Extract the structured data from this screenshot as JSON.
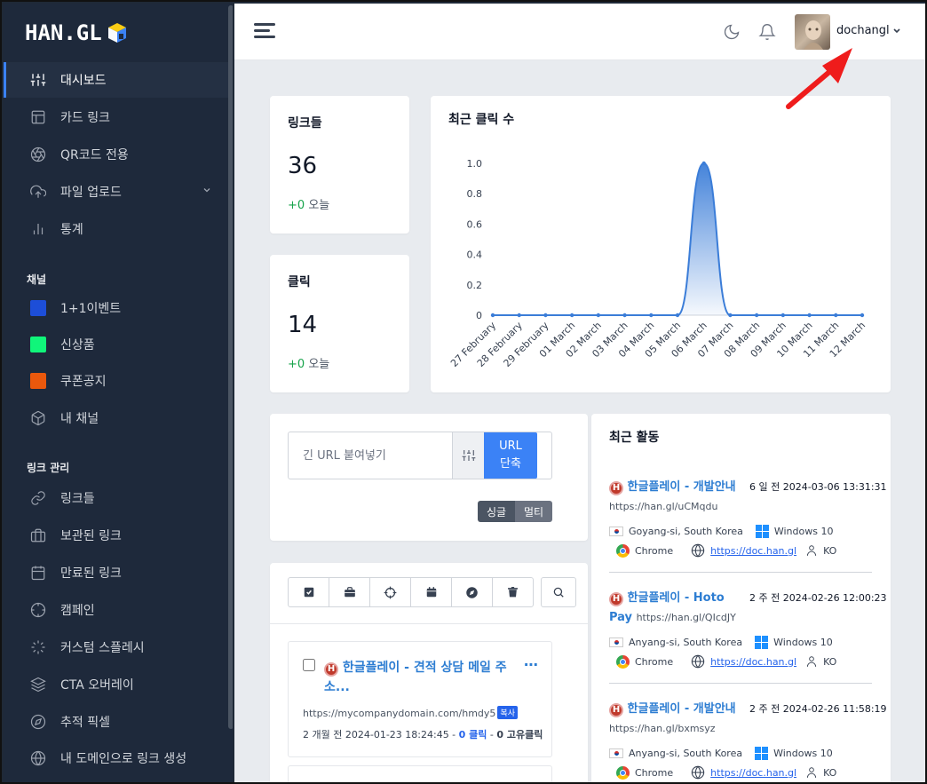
{
  "brand": {
    "logo_text": "HAN.GL"
  },
  "sidebar": {
    "items": [
      {
        "label": "대시보드",
        "icon": "sliders-icon"
      },
      {
        "label": "카드 링크",
        "icon": "layout-icon"
      },
      {
        "label": "QR코드 전용",
        "icon": "aperture-icon"
      },
      {
        "label": "파일 업로드",
        "icon": "upload-cloud-icon"
      },
      {
        "label": "통계",
        "icon": "bar-chart-icon"
      }
    ],
    "channels_title": "채널",
    "channels": [
      {
        "label": "1+1이벤트",
        "color": "#1d4ed8"
      },
      {
        "label": "신상품",
        "color": "#10f57a"
      },
      {
        "label": "쿠폰공지",
        "color": "#ea580c"
      },
      {
        "label": "내 채널",
        "icon": "box-icon"
      }
    ],
    "links_title": "링크 관리",
    "link_items": [
      {
        "label": "링크들",
        "icon": "link-icon"
      },
      {
        "label": "보관된 링크",
        "icon": "briefcase-icon"
      },
      {
        "label": "만료된 링크",
        "icon": "calendar-icon"
      },
      {
        "label": "캠페인",
        "icon": "crosshair-icon"
      },
      {
        "label": "커스텀 스플레시",
        "icon": "loader-icon"
      },
      {
        "label": "CTA 오버레이",
        "icon": "layers-icon"
      },
      {
        "label": "추적 픽셀",
        "icon": "compass-icon"
      },
      {
        "label": "내 도메인으로 링크 생성",
        "icon": "globe-icon"
      }
    ]
  },
  "topbar": {
    "username": "dochangl"
  },
  "stats": {
    "links": {
      "title": "링크들",
      "value": "36",
      "today_delta": "+0",
      "today_label": "오늘"
    },
    "clicks": {
      "title": "클릭",
      "value": "14",
      "today_delta": "+0",
      "today_label": "오늘"
    }
  },
  "chart_data": {
    "type": "area",
    "title": "최근 클릭 수",
    "categories": [
      "27 February",
      "28 February",
      "29 February",
      "01 March",
      "02 March",
      "03 March",
      "04 March",
      "05 March",
      "06 March",
      "07 March",
      "08 March",
      "09 March",
      "10 March",
      "11 March",
      "12 March"
    ],
    "values": [
      0,
      0,
      0,
      0,
      0,
      0,
      0,
      0,
      1,
      0,
      0,
      0,
      0,
      0,
      0
    ],
    "yticks": [
      "0",
      "0.2",
      "0.4",
      "0.6",
      "0.8",
      "1.0"
    ],
    "ylim": [
      0,
      1
    ],
    "color": "#3b7dd8"
  },
  "shorten": {
    "placeholder": "긴 URL 붙여넣기",
    "button_line1": "URL",
    "button_line2": "단축",
    "single": "싱글",
    "multi": "멀티"
  },
  "link_list": {
    "first": {
      "title": "한글플레이 - 견적 상담 메일 주소...",
      "url": "https://mycompanydomain.com/hmdy5",
      "copy": "복사",
      "age": "2 개월 전",
      "date": "2024-01-23 18:24:45",
      "clicks": "0 클릭",
      "unique": "0 고유클릭"
    }
  },
  "activity": {
    "title": "최근 활동",
    "items": [
      {
        "name": "한글플레이 - 개발안내",
        "short": "https://han.gl/uCMqdu",
        "time": "6 일 전 2024-03-06 13:31:31",
        "location": "Goyang-si, South Korea",
        "os": "Windows 10",
        "browser": "Chrome",
        "referrer": "https://doc.han.gl",
        "lang": "KO"
      },
      {
        "name": "한글플레이 - Hoto Pay",
        "short": "https://han.gl/QIcdJY",
        "time": "2 주 전 2024-02-26 12:00:23",
        "location": "Anyang-si, South Korea",
        "os": "Windows 10",
        "browser": "Chrome",
        "referrer": "https://doc.han.gl",
        "lang": "KO"
      },
      {
        "name": "한글플레이 - 개발안내",
        "short": "https://han.gl/bxmsyz",
        "time": "2 주 전 2024-02-26 11:58:19",
        "location": "Anyang-si, South Korea",
        "os": "Windows 10",
        "browser": "Chrome",
        "referrer": "https://doc.han.gl",
        "lang": "KO"
      }
    ]
  }
}
